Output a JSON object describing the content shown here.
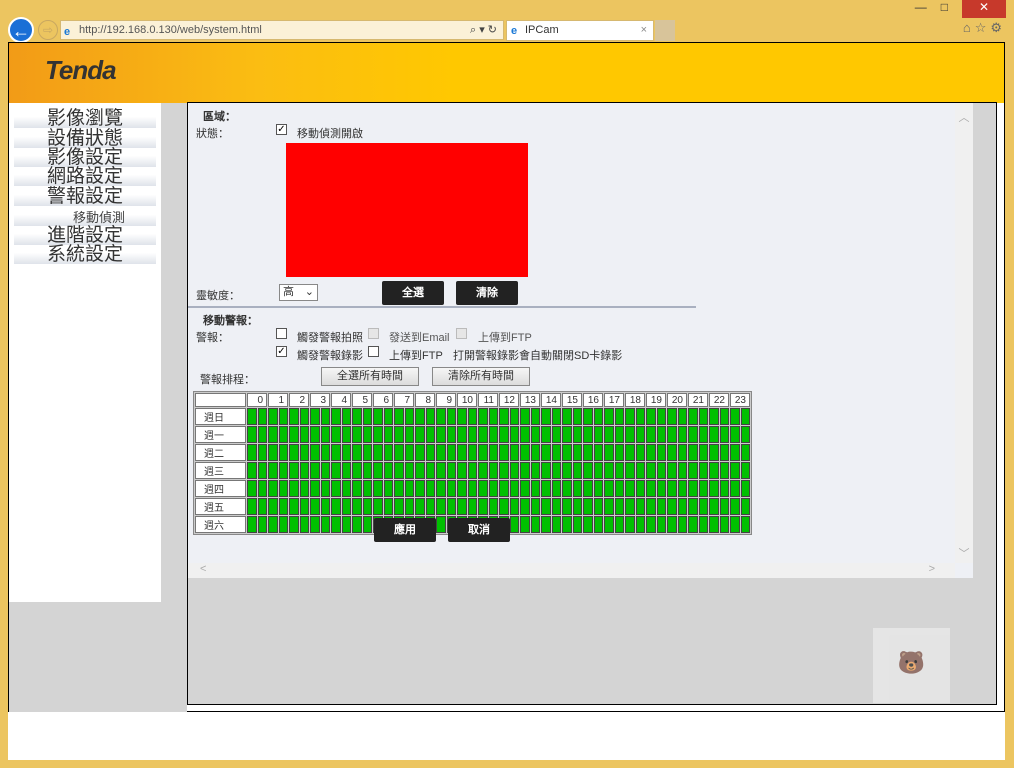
{
  "browser": {
    "url": "http://192.168.0.130/web/system.html",
    "tab_title": "IPCam",
    "tab_close": "×",
    "toolbar_icons": [
      "home-icon",
      "star-icon",
      "gear-icon"
    ],
    "window_buttons": [
      "—",
      "□",
      "✕"
    ]
  },
  "header": {
    "logo": "Tenda"
  },
  "sidebar": {
    "items": [
      {
        "label": "影像瀏覽"
      },
      {
        "label": "設備狀態"
      },
      {
        "label": "影像設定"
      },
      {
        "label": "網路設定"
      },
      {
        "label": "警報設定"
      },
      {
        "label": "移動偵測",
        "sub": true
      },
      {
        "label": "進階設定"
      },
      {
        "label": "系統設定"
      }
    ]
  },
  "area": {
    "title": "區域：",
    "status_label": "狀態：",
    "motion_enable_label": "移動偵測開啟",
    "motion_enabled": true,
    "detect_area_color": "#ff0000",
    "sensitivity_label": "靈敏度：",
    "sensitivity_value": "高",
    "select_all": "全選",
    "clear": "清除"
  },
  "alarm": {
    "title": "移動警報：",
    "alarm_label": "警報：",
    "trigger_snapshot": "觸發警報拍照",
    "send_email": "發送到Email",
    "upload_ftp1": "上傳到FTP",
    "trigger_record": "觸發警報錄影",
    "upload_ftp2": "上傳到FTP",
    "note": "打開警報錄影會自動關閉SD卡錄影",
    "schedule_label": "警報排程：",
    "select_all_time": "全選所有時間",
    "clear_all_time": "清除所有時間"
  },
  "schedule": {
    "hours": [
      "0",
      "1",
      "2",
      "3",
      "4",
      "5",
      "6",
      "7",
      "8",
      "9",
      "10",
      "11",
      "12",
      "13",
      "14",
      "15",
      "16",
      "17",
      "18",
      "19",
      "20",
      "21",
      "22",
      "23"
    ],
    "days": [
      "週日",
      "週一",
      "週二",
      "週三",
      "週四",
      "週五",
      "週六"
    ],
    "all_selected": true,
    "selected_color": "#00c000"
  },
  "actions": {
    "apply": "應用",
    "cancel": "取消"
  }
}
